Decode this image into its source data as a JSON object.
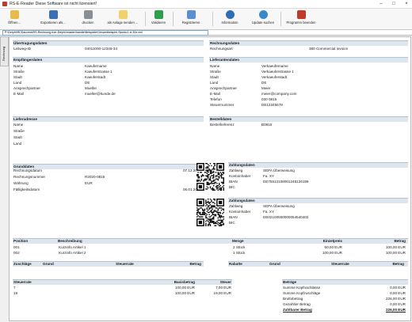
{
  "window": {
    "title": "RS-E-Reader Diese Software ist nicht lizensiert!",
    "minimize": "–",
    "maximize": "□",
    "close": "×"
  },
  "toolbar": {
    "open": "Öffnen...",
    "export": "Exportieren als...",
    "print": "drucken",
    "send": "als Anlage senden ...",
    "validate": "Validieren",
    "register": "Registrieren",
    "info": "Information",
    "update": "Update suchen",
    "exit": "Programm beenden"
  },
  "path": "P:\\Delphi\\RCDaccess\\RS-Rechnung-fuer-Delphi\\master\\handle\\Beispiele\\Gesamtbeispiel-Skonto1-xi-30x.xml",
  "sidetab": "Rechnung",
  "transmission": {
    "title": "Übertragungsdaten",
    "leitweg_label": "Leitweg-ID",
    "leitweg_value": "04011000-12345-34"
  },
  "invoice_type": {
    "title": "Rechnungsdaten",
    "label": "Rechnungsart",
    "value": "380 Commercial invoice"
  },
  "recipient": {
    "title": "Empfängerdaten",
    "rows": [
      {
        "label": "Name",
        "value": "Kaeufername"
      },
      {
        "label": "Straße",
        "value": "Kaeuferstrasse 1"
      },
      {
        "label": "Stadt",
        "value": "Kaeuferstadt"
      },
      {
        "label": "Land",
        "value": "DE"
      },
      {
        "label": "Ansprechpartner",
        "value": "Mueller"
      },
      {
        "label": "E-Mail",
        "value": "mueller@kunde.de"
      }
    ]
  },
  "supplier": {
    "title": "Lieferantendaten",
    "rows": [
      {
        "label": "Name",
        "value": "Verkaeufername"
      },
      {
        "label": "Straße",
        "value": "Verkaeuferstrasse 1"
      },
      {
        "label": "Stadt",
        "value": "Verkaeuferstadt"
      },
      {
        "label": "Land",
        "value": "DE"
      },
      {
        "label": "Ansprechpartner",
        "value": "Meier"
      },
      {
        "label": "E-Mail",
        "value": "meier@company.com"
      },
      {
        "label": "Telefon",
        "value": "030 0815"
      },
      {
        "label": "Steuernummer",
        "value": "DE12345678"
      }
    ]
  },
  "delivery": {
    "title": "Lieferadresse",
    "rows": [
      {
        "label": "Name"
      },
      {
        "label": "Straße"
      },
      {
        "label": "Stadt"
      },
      {
        "label": "Land"
      }
    ]
  },
  "order": {
    "title": "Bestelldaten",
    "label": "Bestellreferenz",
    "value": "B0815"
  },
  "basic": {
    "title": "Grunddaten",
    "rows": [
      {
        "label": "Rechnungsdatum",
        "value": "07.12.2024"
      },
      {
        "label": "Rechnungsnummer",
        "value": "R2020-0815"
      },
      {
        "label": "Währung",
        "value": "EUR"
      },
      {
        "label": "Fälligkeitsdatum",
        "value": "06.01.2025"
      }
    ]
  },
  "payment1": {
    "title": "Zahlungsdaten",
    "rows": [
      {
        "label": "Zahlweg",
        "value": "SEPA Überweisung"
      },
      {
        "label": "Kontoinhaber",
        "value": "Fa. XY"
      },
      {
        "label": "IBAN",
        "value": "DE75512108001245126199"
      },
      {
        "label": "BIC",
        "value": ""
      }
    ]
  },
  "payment2": {
    "title": "Zahlungsdaten",
    "rows": [
      {
        "label": "Zahlweg",
        "value": "SEPA Überweisung"
      },
      {
        "label": "Kontoinhaber",
        "value": "Fa. XY"
      },
      {
        "label": "IBAN",
        "value": "DE02100500000054540402"
      },
      {
        "label": "BIC",
        "value": ""
      }
    ]
  },
  "positions": {
    "headers": {
      "pos": "Position",
      "desc": "Beschreibung",
      "qty": "Menge",
      "unit": "Einzelpreis",
      "amount": "Betrag"
    },
    "rows": [
      {
        "pos": "001",
        "desc": "Kurzinfo Artikel 1",
        "qty": "2 Stück",
        "unit": "50,00 EUR",
        "amount": "100,00 EUR"
      },
      {
        "pos": "002",
        "desc": "Kurzinfo Artikel 2",
        "qty": "1 Stück",
        "unit": "100,00 EUR",
        "amount": "100,00 EUR"
      }
    ]
  },
  "surcharges": {
    "title": "Zuschläge",
    "grund": "Grund",
    "rate": "Steuerrate",
    "amount": "Betrag"
  },
  "discounts": {
    "title": "Rabatte",
    "grund": "Grund",
    "rate": "Steuerrate",
    "amount": "Betrag"
  },
  "taxes": {
    "headers": {
      "rate": "Steuerrate",
      "base": "Basisbetrag",
      "tax": "Steuer"
    },
    "rows": [
      {
        "rate": "7",
        "base": "100,00 EUR",
        "tax": "7,00 EUR"
      },
      {
        "rate": "19",
        "base": "100,00 EUR",
        "tax": "19,00 EUR"
      }
    ]
  },
  "totals": {
    "title": "Beträge",
    "rows": [
      {
        "label": "Summe Kopfnachlässe",
        "value": "0,00 EUR"
      },
      {
        "label": "Summe Kopfzuschläge",
        "value": "0,00 EUR"
      },
      {
        "label": "Bruttobetrag",
        "value": "226,00 EUR"
      },
      {
        "label": "Gezahlter Betrag",
        "value": "0,00 EUR"
      }
    ],
    "due_label": "Zahlbarer Betrag",
    "due_value": "226,00 EUR"
  },
  "colors": {
    "header_bg": "#dde6ef",
    "accent": "#2f6db5"
  }
}
